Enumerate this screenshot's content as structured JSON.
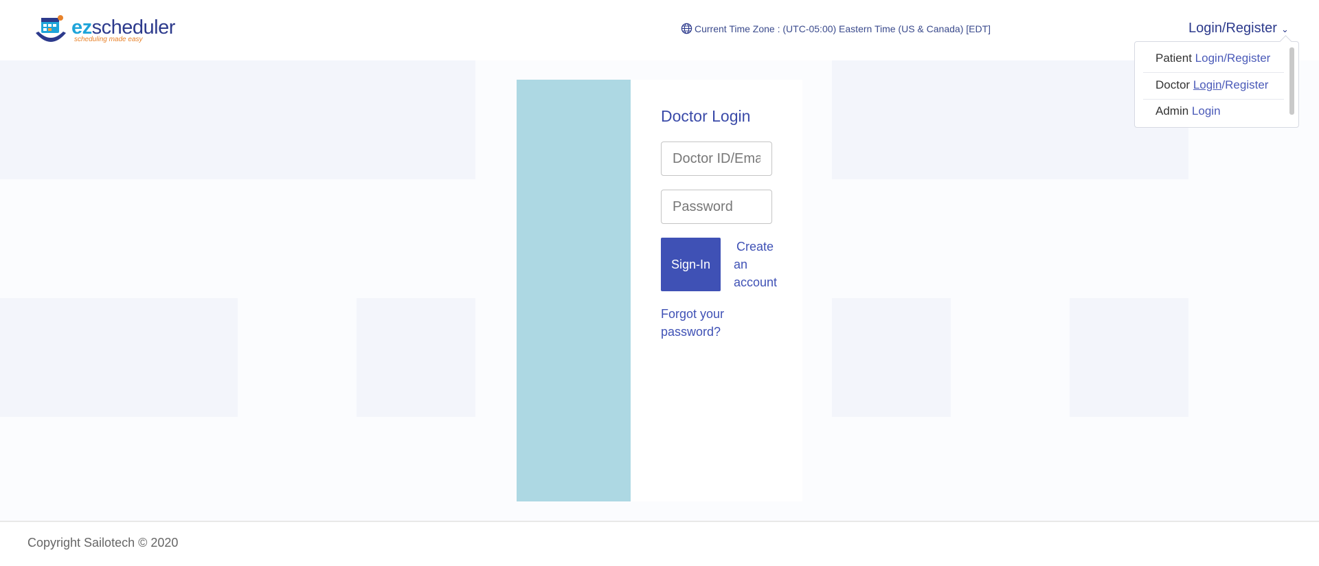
{
  "header": {
    "logo": {
      "ez": "ez",
      "rest": "scheduler",
      "tagline": "scheduling made easy"
    },
    "timezone_text": "Current Time Zone : (UTC-05:00) Eastern Time (US & Canada) [EDT]",
    "login_menu_label": "Login/Register"
  },
  "dropdown": {
    "items": [
      {
        "prefix": "Patient",
        "link1": "Login",
        "sep": "/",
        "link2": "Register"
      },
      {
        "prefix": "Doctor",
        "link1": "Login",
        "sep": "/",
        "link2": "Register"
      },
      {
        "prefix": "Admin",
        "link1": "Login"
      }
    ]
  },
  "login_card": {
    "title": "Doctor Login",
    "id_placeholder": "Doctor ID/Email",
    "password_placeholder": "Password",
    "signin_label": "Sign-In",
    "create_account_label": "Create an account",
    "forgot_label": "Forgot your password?"
  },
  "footer": {
    "copyright": "Copyright Sailotech © 2020"
  },
  "colors": {
    "brand_blue": "#3f51b5",
    "side_panel": "#add8e3",
    "link": "#4a5ab8"
  }
}
